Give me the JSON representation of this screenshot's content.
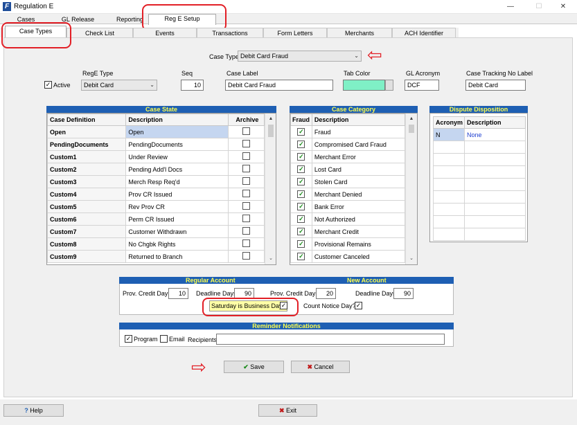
{
  "window": {
    "title": "Regulation E",
    "app_icon_letter": "F",
    "minimize": "—",
    "maximize": "☐",
    "close": "✕"
  },
  "top_tabs": [
    "Cases",
    "GL Release",
    "Reporting",
    "Reg E Setup"
  ],
  "sub_tabs": [
    "Case Types",
    "Check List",
    "Events",
    "Transactions",
    "Form Letters",
    "Merchants",
    "ACH Identifier"
  ],
  "case_type": {
    "label": "Case Type",
    "value": "Debit Card Fraud"
  },
  "fields": {
    "active_label": "Active",
    "rege_type_label": "RegE Type",
    "rege_type_value": "Debit Card",
    "seq_label": "Seq",
    "seq_value": "10",
    "case_label_label": "Case Label",
    "case_label_value": "Debit Card Fraud",
    "tab_color_label": "Tab Color",
    "tab_color_value": "#7ff0c6",
    "gl_acronym_label": "GL Acronym",
    "gl_acronym_value": "DCF",
    "tracking_label": "Case Tracking No Label",
    "tracking_value": "Debit Card"
  },
  "case_state": {
    "title": "Case State",
    "headers": [
      "Case Definition",
      "Description",
      "Archive"
    ],
    "rows": [
      {
        "def": "Open",
        "desc": "Open"
      },
      {
        "def": "PendingDocuments",
        "desc": "PendingDocuments"
      },
      {
        "def": "Custom1",
        "desc": "Under Review"
      },
      {
        "def": "Custom2",
        "desc": "Pending Add'l Docs"
      },
      {
        "def": "Custom3",
        "desc": "Merch Resp Req'd"
      },
      {
        "def": "Custom4",
        "desc": "Prov CR Issued"
      },
      {
        "def": "Custom5",
        "desc": "Rev Prov CR"
      },
      {
        "def": "Custom6",
        "desc": "Perm CR Issued"
      },
      {
        "def": "Custom7",
        "desc": "Customer Withdrawn"
      },
      {
        "def": "Custom8",
        "desc": "No Chgbk Rights"
      },
      {
        "def": "Custom9",
        "desc": "Returned to Branch"
      }
    ]
  },
  "case_category": {
    "title": "Case Category",
    "headers": [
      "Fraud",
      "Description"
    ],
    "rows": [
      "Fraud",
      "Compromised Card Fraud",
      "Merchant Error",
      "Lost Card",
      "Stolen Card",
      "Merchant Denied",
      "Bank Error",
      "Not Authorized",
      "Merchant Credit",
      "Provisional Remains",
      "Customer Canceled"
    ]
  },
  "dispute": {
    "title": "Dispute Disposition",
    "headers": [
      "Acronym",
      "Description"
    ],
    "rows": [
      {
        "acronym": "N",
        "desc": "None"
      }
    ]
  },
  "regular_account": {
    "title": "Regular Account",
    "prov_label": "Prov. Credit Days",
    "prov_value": "10",
    "deadline_label": "Deadline Days",
    "deadline_value": "90",
    "saturday_label": "Saturday is Business Day?"
  },
  "new_account": {
    "title": "New Account",
    "prov_label": "Prov. Credit Days",
    "prov_value": "20",
    "deadline_label": "Deadline Days",
    "deadline_value": "90",
    "count_label": "Count Notice Day?"
  },
  "reminder": {
    "title": "Reminder Notifications",
    "program_label": "Program",
    "email_label": "Email",
    "recipients_label": "Recipients",
    "recipients_value": ""
  },
  "buttons": {
    "save": "Save",
    "cancel": "Cancel",
    "help": "Help",
    "exit": "Exit"
  },
  "colors": {
    "header_blue": "#1e5fb3",
    "header_text": "#ffff4d",
    "annotation_red": "#e21f26"
  }
}
